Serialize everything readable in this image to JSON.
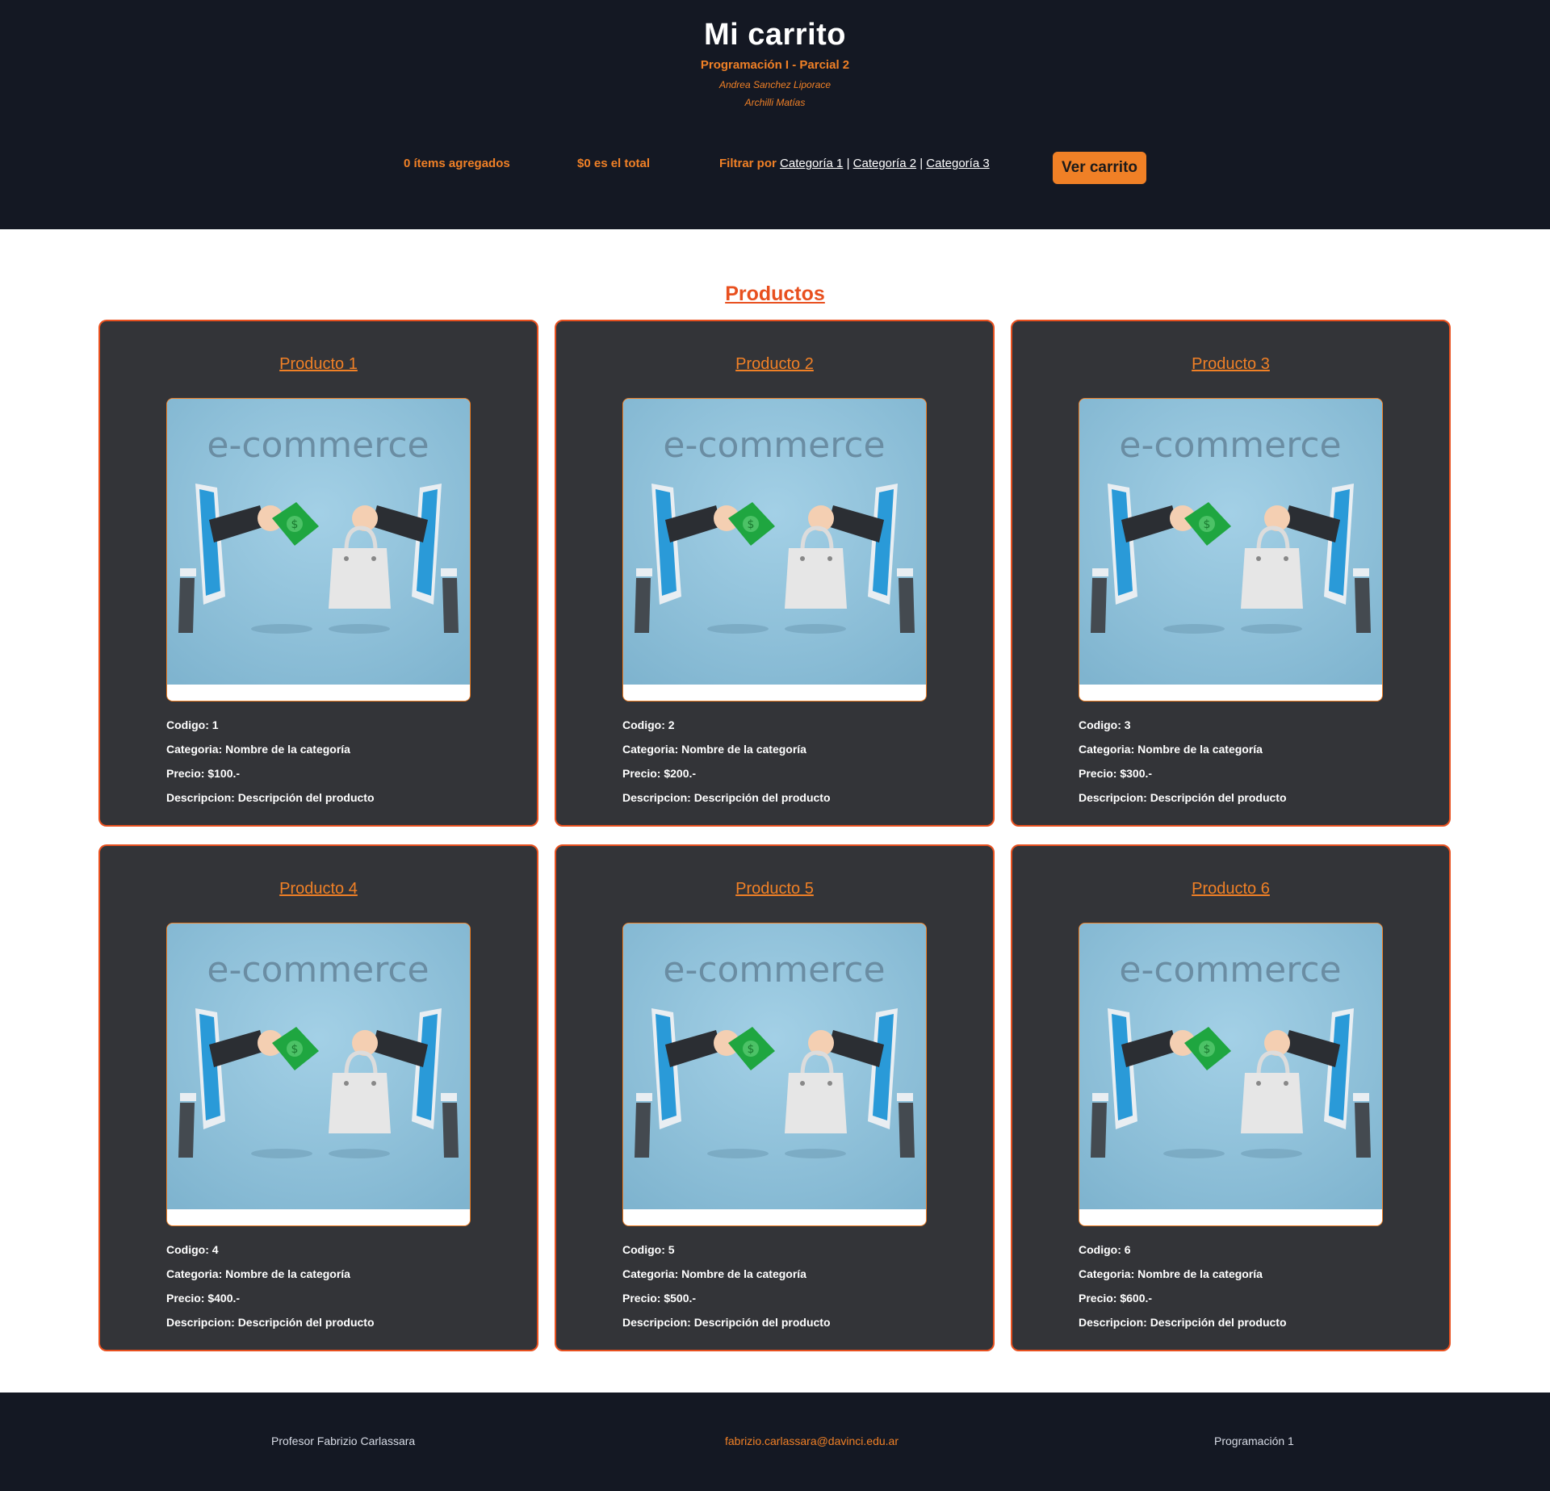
{
  "header": {
    "title": "Mi carrito",
    "subtitle": "Programación I - Parcial 2",
    "authors": [
      "Andrea Sanchez Liporace",
      "Archilli Matías"
    ]
  },
  "cart_bar": {
    "items_text": "0 ítems agregados",
    "total_text": "$0 es el total",
    "filter_label": "Filtrar por",
    "categories": [
      "Categoría 1",
      "Categoría 2",
      "Categoría 3"
    ],
    "separator": "|",
    "view_cart_label": "Ver carrito"
  },
  "products_section": {
    "title": "Productos",
    "image_text": "e-commerce",
    "items": [
      {
        "name": "Producto 1",
        "code_line": "Codigo: 1",
        "category_line": "Categoria: Nombre de la categoría",
        "price_line": "Precio: $100.-",
        "description_line": "Descripcion: Descripción del producto"
      },
      {
        "name": "Producto 2",
        "code_line": "Codigo: 2",
        "category_line": "Categoria: Nombre de la categoría",
        "price_line": "Precio: $200.-",
        "description_line": "Descripcion: Descripción del producto"
      },
      {
        "name": "Producto 3",
        "code_line": "Codigo: 3",
        "category_line": "Categoria: Nombre de la categoría",
        "price_line": "Precio: $300.-",
        "description_line": "Descripcion: Descripción del producto"
      },
      {
        "name": "Producto 4",
        "code_line": "Codigo: 4",
        "category_line": "Categoria: Nombre de la categoría",
        "price_line": "Precio: $400.-",
        "description_line": "Descripcion: Descripción del producto"
      },
      {
        "name": "Producto 5",
        "code_line": "Codigo: 5",
        "category_line": "Categoria: Nombre de la categoría",
        "price_line": "Precio: $500.-",
        "description_line": "Descripcion: Descripción del producto"
      },
      {
        "name": "Producto 6",
        "code_line": "Codigo: 6",
        "category_line": "Categoria: Nombre de la categoría",
        "price_line": "Precio: $600.-",
        "description_line": "Descripcion: Descripción del producto"
      }
    ]
  },
  "footer": {
    "professor": "Profesor Fabrizio Carlassara",
    "email": "fabrizio.carlassara@davinci.edu.ar",
    "course": "Programación 1"
  },
  "colors": {
    "header_bg": "#141823",
    "accent_orange": "#f08026",
    "accent_red": "#e8501f",
    "card_bg": "#333438"
  }
}
